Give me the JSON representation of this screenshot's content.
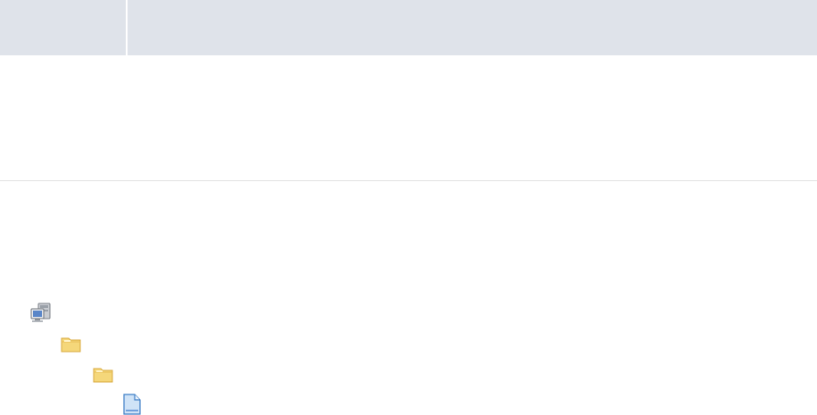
{
  "header": {
    "columns": [
      {
        "label": ""
      },
      {
        "label": ""
      }
    ]
  },
  "tree": {
    "nodes": [
      {
        "icon": "computer-icon",
        "label": ""
      },
      {
        "icon": "folder-icon",
        "label": ""
      },
      {
        "icon": "folder-icon",
        "label": ""
      },
      {
        "icon": "file-icon",
        "label": ""
      }
    ]
  },
  "colors": {
    "header_background": "#dfe3ea",
    "divider": "#e2e2e2",
    "folder_fill": "#f5d77a",
    "folder_border": "#d8a93c",
    "file_fill": "#cfe3f7",
    "file_border": "#3f7fc6",
    "computer_screen": "#5a86c8"
  }
}
